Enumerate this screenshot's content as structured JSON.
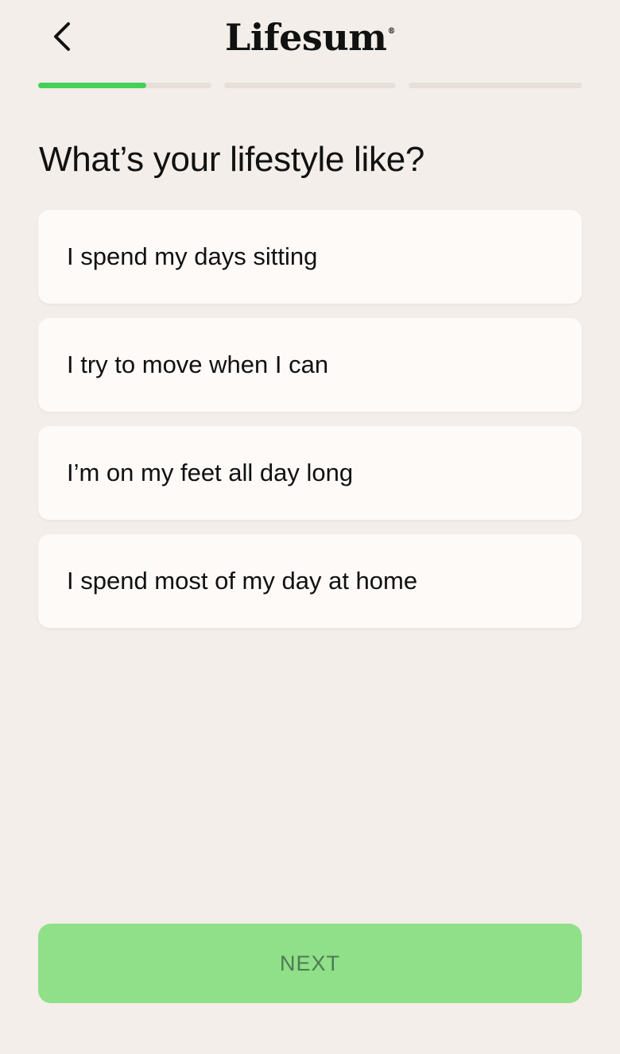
{
  "header": {
    "back_icon": "chevron-left-icon",
    "logo_text": "Lifesum",
    "logo_mark": "®"
  },
  "progress": {
    "steps": 3,
    "current_step": 1,
    "current_step_fraction": 0.62,
    "active_color": "#45d05a",
    "track_color": "#e7dfda"
  },
  "question": "What’s your lifestyle like?",
  "options": [
    {
      "label": "I spend my days sitting"
    },
    {
      "label": "I try to move when I can"
    },
    {
      "label": "I’m on my feet all day long"
    },
    {
      "label": "I spend most of my day at home"
    }
  ],
  "next_button": {
    "label": "NEXT",
    "color": "#8fe088"
  }
}
